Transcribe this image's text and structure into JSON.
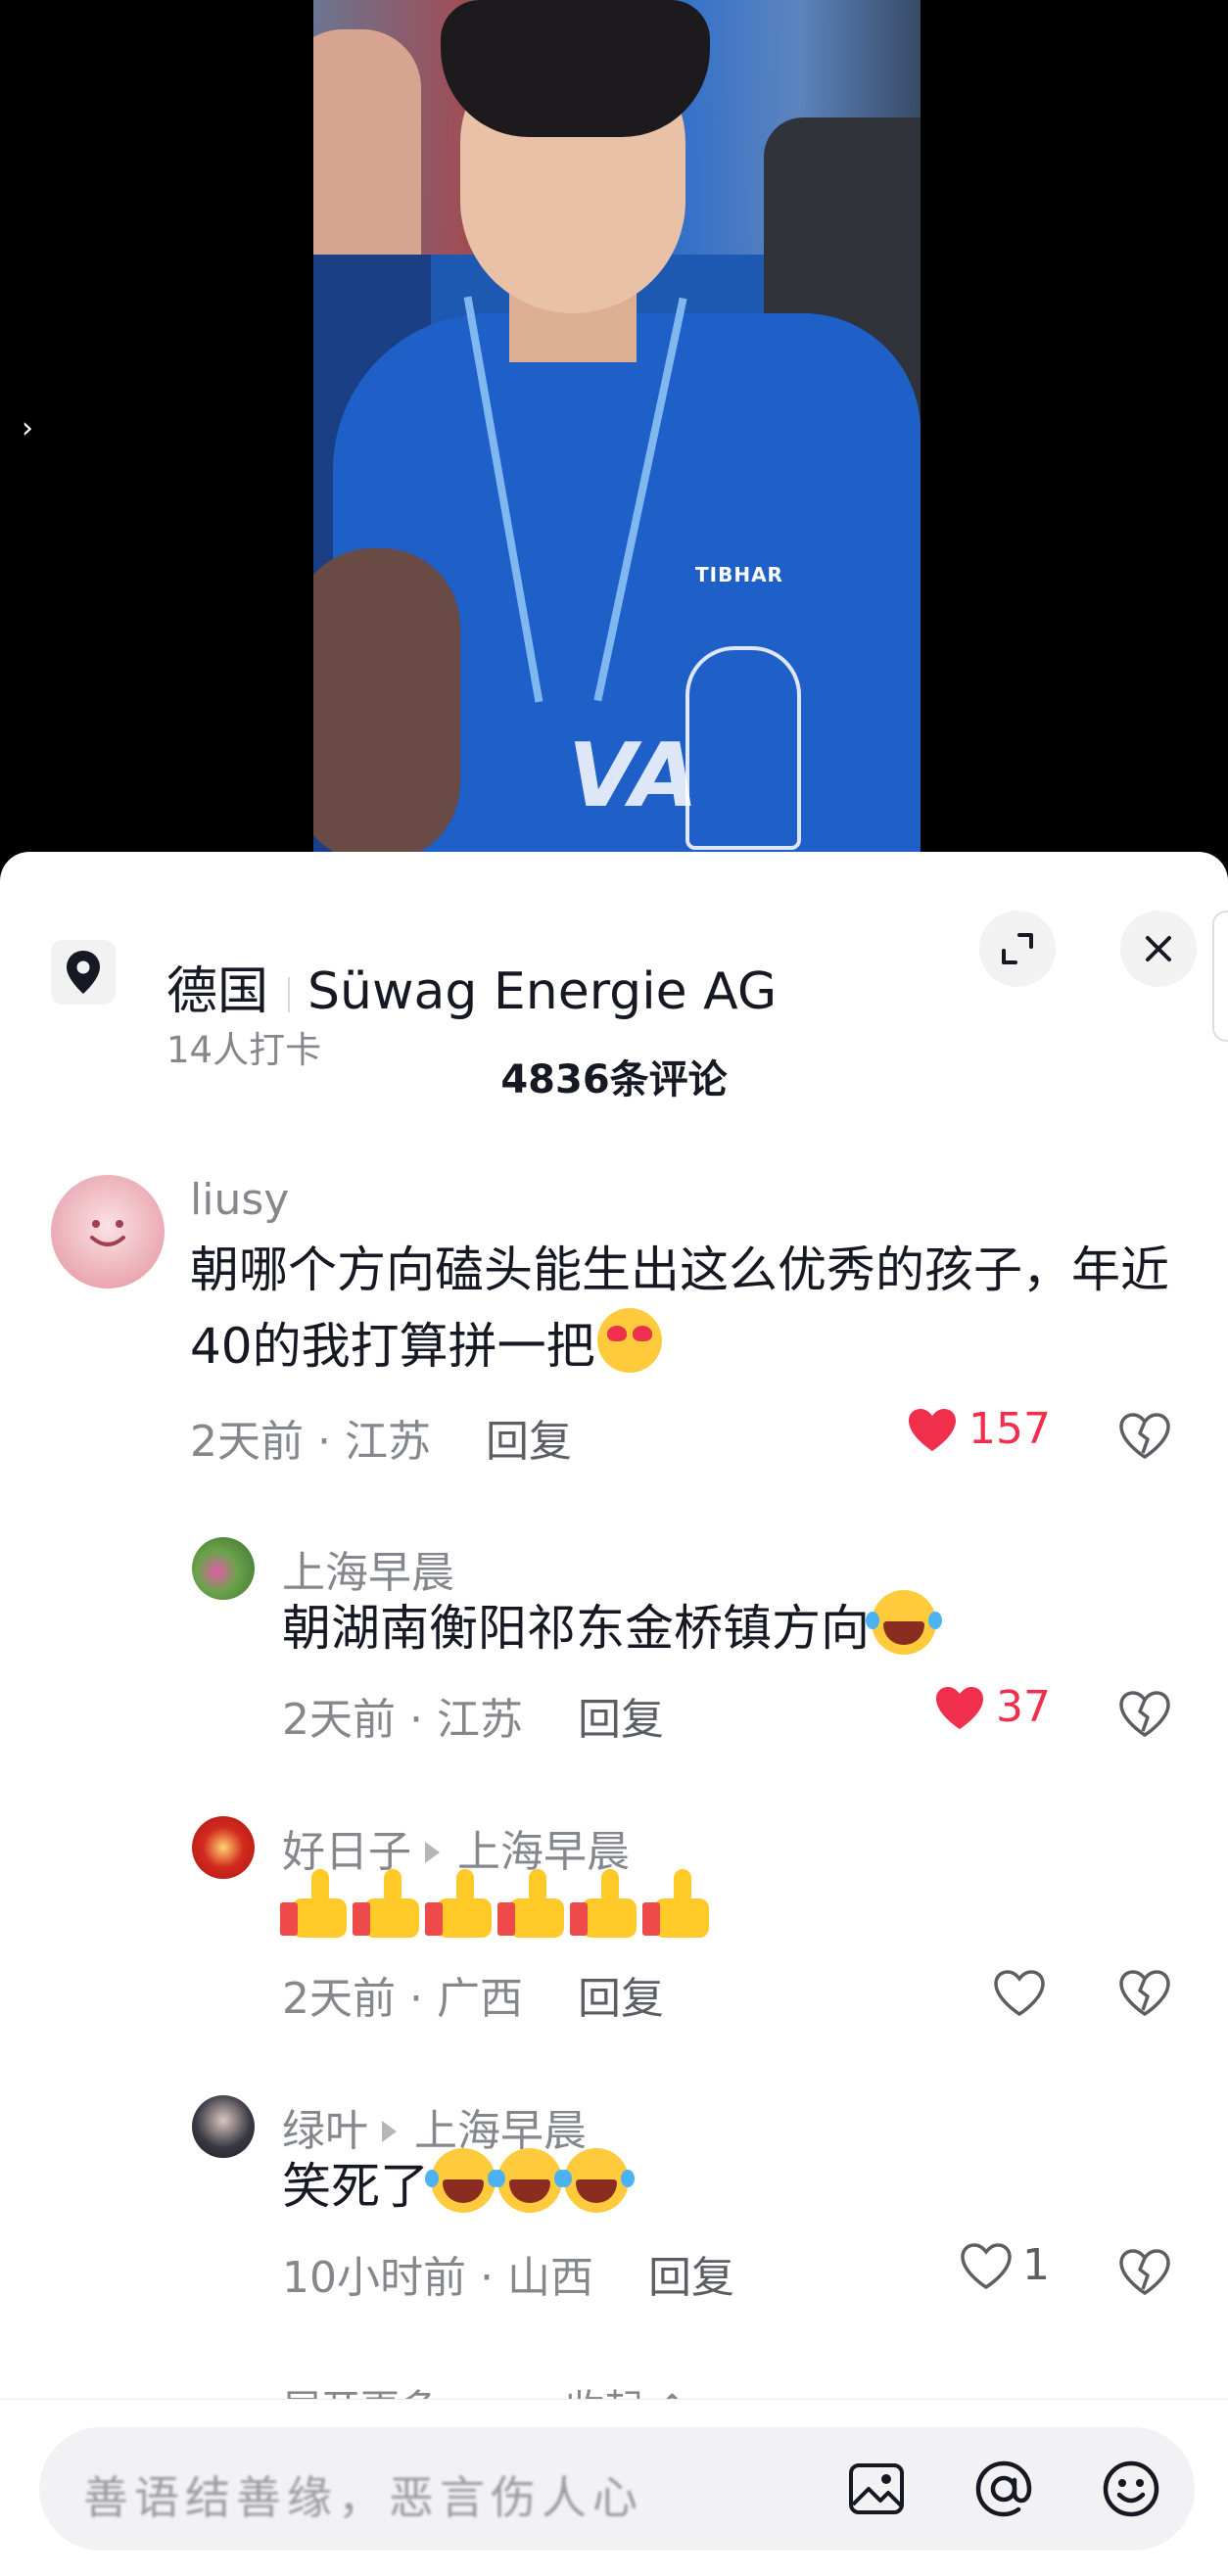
{
  "video": {
    "brand": "TIBHAR"
  },
  "location": {
    "country": "德国",
    "place": "Süwag Energie AG",
    "checkins": "14人打卡"
  },
  "comments_count": "4836条评论",
  "comments": [
    {
      "user": "liusy",
      "text": "朝哪个方向磕头能生出这么优秀的孩子，年近40的我打算拼一把",
      "time": "2天前",
      "region": "江苏",
      "reply": "回复",
      "likes": "157"
    },
    {
      "user": "上海早晨",
      "text": "朝湖南衡阳祁东金桥镇方向",
      "time": "2天前",
      "region": "江苏",
      "reply": "回复",
      "likes": "37"
    },
    {
      "user": "好日子",
      "reply_to": "上海早晨",
      "text": "",
      "time": "2天前",
      "region": "广西",
      "reply": "回复",
      "likes": ""
    },
    {
      "user": "绿叶",
      "reply_to": "上海早晨",
      "text": "笑死了",
      "time": "10小时前",
      "region": "山西",
      "reply": "回复",
      "likes": "1"
    }
  ],
  "more": {
    "expand": "展开更多",
    "collapse": "收起"
  },
  "input": {
    "placeholder": "善语结善缘，恶言伤人心"
  },
  "colors": {
    "like_red": "#ef2f4c",
    "gray": "#86878c"
  }
}
